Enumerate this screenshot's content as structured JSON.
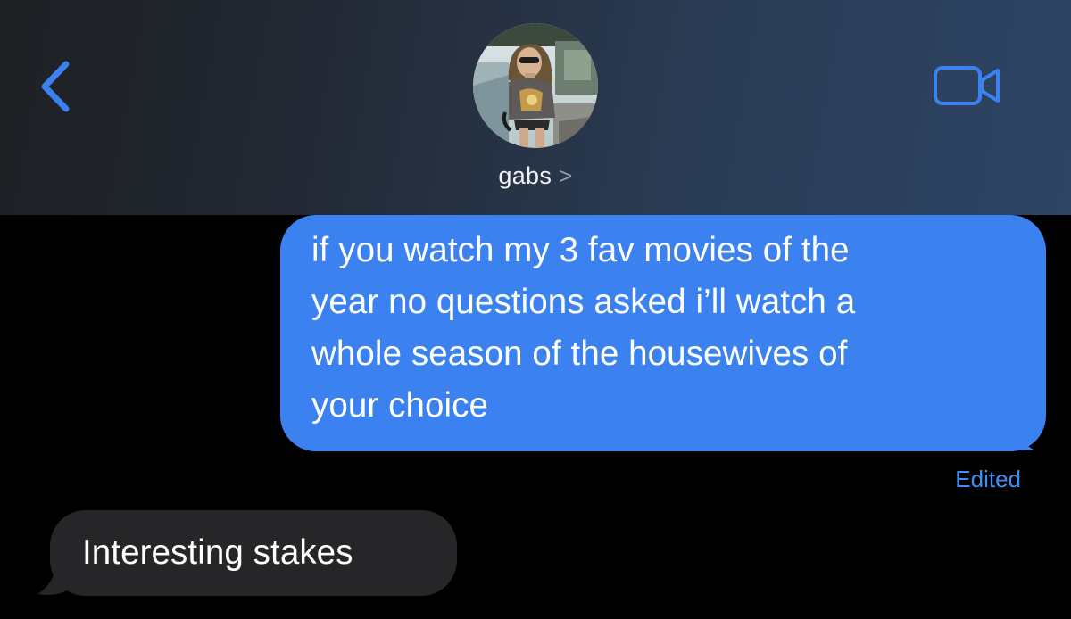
{
  "header": {
    "contact_name": "gabs",
    "name_chevron": ">",
    "back_icon": "chevron-left-icon",
    "video_icon": "video-camera-icon",
    "accent_color": "#3b82f0"
  },
  "messages": {
    "outgoing": {
      "text": "if you watch my 3 fav movies of the\nyear no questions asked i’ll watch a\nwhole season of the housewives of\nyour choice",
      "status": "Edited",
      "color": "#3b82f0"
    },
    "incoming": {
      "text": "Interesting stakes",
      "color": "#262628"
    }
  }
}
